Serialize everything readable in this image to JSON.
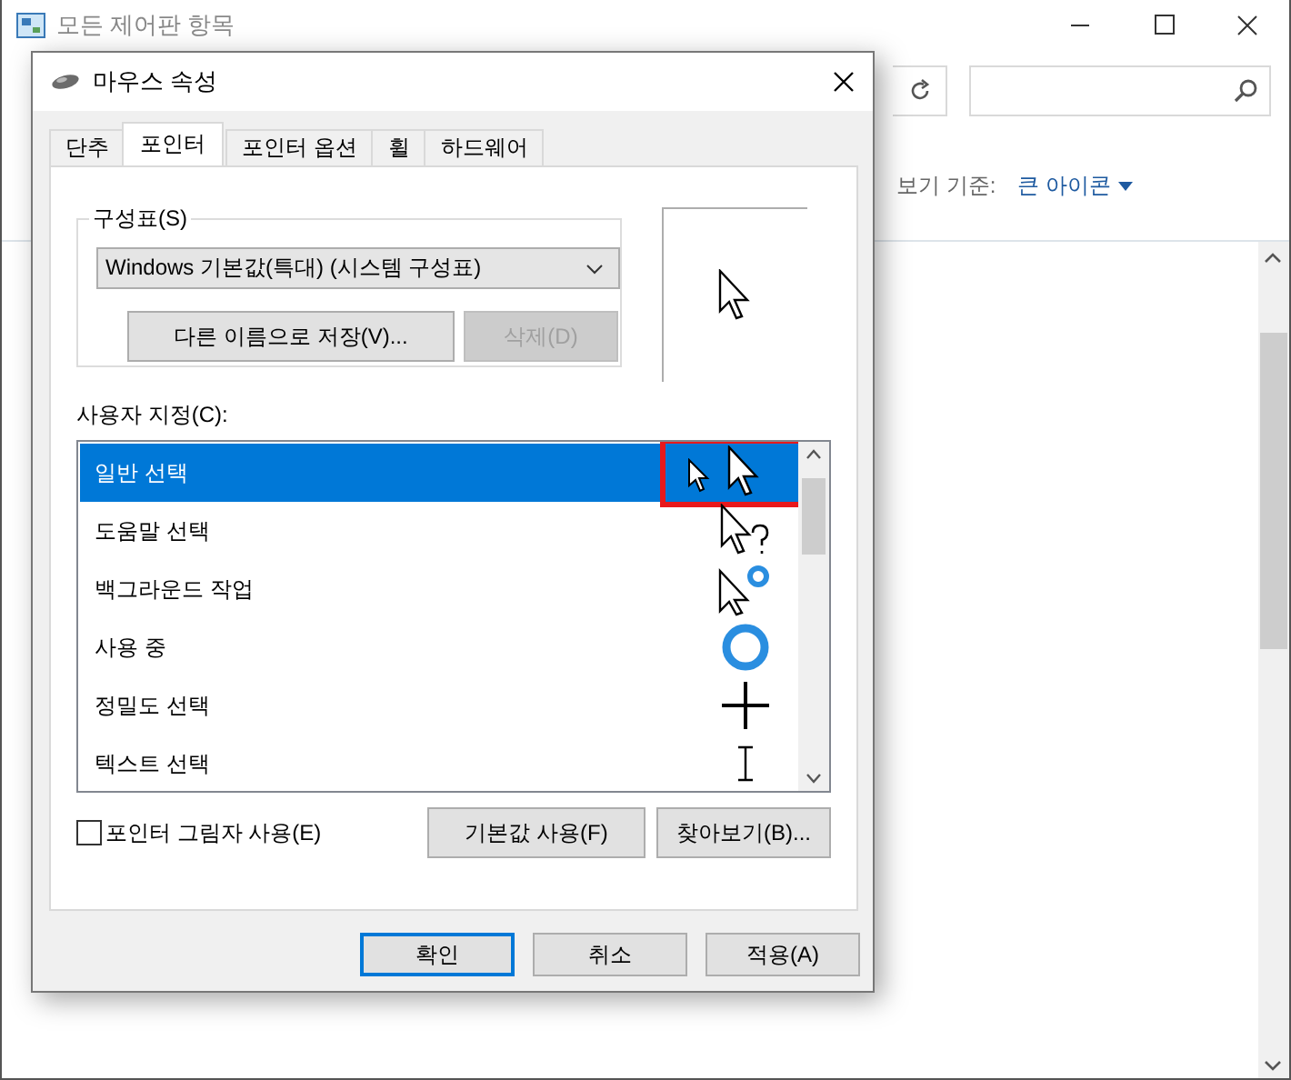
{
  "window": {
    "title": "모든 제어판 항목"
  },
  "view_by": {
    "label": "보기 기준:",
    "value": "큰 아이콘"
  },
  "dialog": {
    "title": "마우스 속성",
    "tabs": [
      {
        "label": "단추",
        "selected": false
      },
      {
        "label": "포인터",
        "selected": true
      },
      {
        "label": "포인터 옵션",
        "selected": false
      },
      {
        "label": "휠",
        "selected": false
      },
      {
        "label": "하드웨어",
        "selected": false
      }
    ],
    "scheme": {
      "label": "구성표(S)",
      "value": "Windows 기본값(특대) (시스템 구성표)",
      "buttons": [
        {
          "label": "다른 이름으로 저장(V)...",
          "disabled": false
        },
        {
          "label": "삭제(D)",
          "disabled": true
        }
      ]
    },
    "customize": {
      "label": "사용자 지정(C):",
      "items": [
        {
          "label": "일반 선택",
          "kind": "normal",
          "selected": true,
          "highlighted": true
        },
        {
          "label": "도움말 선택",
          "kind": "help",
          "selected": false,
          "highlighted": false
        },
        {
          "label": "백그라운드 작업",
          "kind": "working",
          "selected": false,
          "highlighted": false
        },
        {
          "label": "사용 중",
          "kind": "busy",
          "selected": false,
          "highlighted": false
        },
        {
          "label": "정밀도 선택",
          "kind": "precision",
          "selected": false,
          "highlighted": false
        },
        {
          "label": "텍스트 선택",
          "kind": "text",
          "selected": false,
          "highlighted": false
        }
      ]
    },
    "shadow": {
      "label": "포인터 그림자 사용(E)",
      "checked": false
    },
    "list_buttons": [
      "기본값 사용(F)",
      "찾아보기(B)..."
    ],
    "buttons": [
      {
        "label": "확인",
        "default": true
      },
      {
        "label": "취소",
        "default": false
      },
      {
        "label": "적용(A)",
        "default": false
      }
    ]
  }
}
